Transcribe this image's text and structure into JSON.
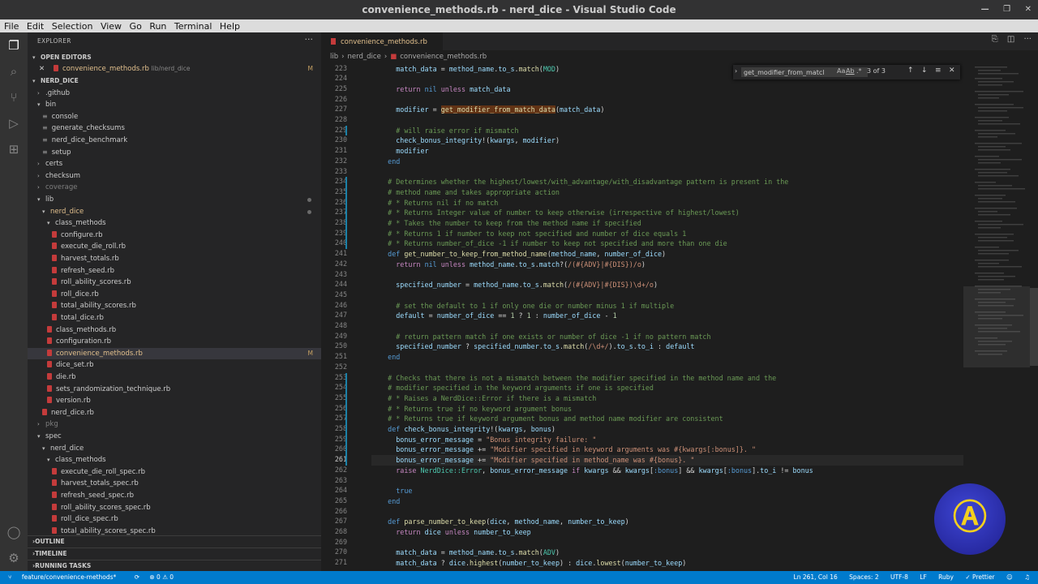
{
  "window": {
    "title": "convenience_methods.rb - nerd_dice - Visual Studio Code"
  },
  "menu": [
    "File",
    "Edit",
    "Selection",
    "View",
    "Go",
    "Run",
    "Terminal",
    "Help"
  ],
  "sidebar": {
    "header": "EXPLORER",
    "open_editors_label": "OPEN EDITORS",
    "open_editor": {
      "name": "convenience_methods.rb",
      "path": "lib/nerd_dice",
      "badge": "M"
    },
    "root_label": "NERD_DICE",
    "tree": [
      {
        "label": ".github",
        "kind": "folder",
        "indent": 1,
        "open": false
      },
      {
        "label": "bin",
        "kind": "folder",
        "indent": 1,
        "open": true
      },
      {
        "label": "console",
        "kind": "file",
        "indent": 2
      },
      {
        "label": "generate_checksums",
        "kind": "file",
        "indent": 2
      },
      {
        "label": "nerd_dice_benchmark",
        "kind": "file",
        "indent": 2
      },
      {
        "label": "setup",
        "kind": "file",
        "indent": 2
      },
      {
        "label": "certs",
        "kind": "folder",
        "indent": 1,
        "open": false
      },
      {
        "label": "checksum",
        "kind": "folder",
        "indent": 1,
        "open": false
      },
      {
        "label": "coverage",
        "kind": "folder",
        "indent": 1,
        "open": false,
        "dim": true
      },
      {
        "label": "lib",
        "kind": "folder",
        "indent": 1,
        "open": true,
        "dot": true
      },
      {
        "label": "nerd_dice",
        "kind": "folder",
        "indent": 2,
        "open": true,
        "dot": true,
        "mod": true
      },
      {
        "label": "class_methods",
        "kind": "folder",
        "indent": 3,
        "open": true
      },
      {
        "label": "configure.rb",
        "kind": "rb",
        "indent": 4
      },
      {
        "label": "execute_die_roll.rb",
        "kind": "rb",
        "indent": 4
      },
      {
        "label": "harvest_totals.rb",
        "kind": "rb",
        "indent": 4
      },
      {
        "label": "refresh_seed.rb",
        "kind": "rb",
        "indent": 4
      },
      {
        "label": "roll_ability_scores.rb",
        "kind": "rb",
        "indent": 4
      },
      {
        "label": "roll_dice.rb",
        "kind": "rb",
        "indent": 4
      },
      {
        "label": "total_ability_scores.rb",
        "kind": "rb",
        "indent": 4
      },
      {
        "label": "total_dice.rb",
        "kind": "rb",
        "indent": 4
      },
      {
        "label": "class_methods.rb",
        "kind": "rb",
        "indent": 3
      },
      {
        "label": "configuration.rb",
        "kind": "rb",
        "indent": 3
      },
      {
        "label": "convenience_methods.rb",
        "kind": "rb",
        "indent": 3,
        "selected": true,
        "mod": true,
        "badge": "M"
      },
      {
        "label": "dice_set.rb",
        "kind": "rb",
        "indent": 3
      },
      {
        "label": "die.rb",
        "kind": "rb",
        "indent": 3
      },
      {
        "label": "sets_randomization_technique.rb",
        "kind": "rb",
        "indent": 3
      },
      {
        "label": "version.rb",
        "kind": "rb",
        "indent": 3
      },
      {
        "label": "nerd_dice.rb",
        "kind": "rb",
        "indent": 2
      },
      {
        "label": "pkg",
        "kind": "folder",
        "indent": 1,
        "open": false,
        "dim": true
      },
      {
        "label": "spec",
        "kind": "folder",
        "indent": 1,
        "open": true
      },
      {
        "label": "nerd_dice",
        "kind": "folder",
        "indent": 2,
        "open": true
      },
      {
        "label": "class_methods",
        "kind": "folder",
        "indent": 3,
        "open": true
      },
      {
        "label": "execute_die_roll_spec.rb",
        "kind": "rb",
        "indent": 4
      },
      {
        "label": "harvest_totals_spec.rb",
        "kind": "rb",
        "indent": 4
      },
      {
        "label": "refresh_seed_spec.rb",
        "kind": "rb",
        "indent": 4
      },
      {
        "label": "roll_ability_scores_spec.rb",
        "kind": "rb",
        "indent": 4
      },
      {
        "label": "roll_dice_spec.rb",
        "kind": "rb",
        "indent": 4
      },
      {
        "label": "total_ability_scores_spec.rb",
        "kind": "rb",
        "indent": 4
      }
    ],
    "sections": [
      "OUTLINE",
      "TIMELINE",
      "RUNNING TASKS"
    ]
  },
  "tab": {
    "label": "convenience_methods.rb",
    "badge": "M"
  },
  "breadcrumb": [
    "lib",
    "nerd_dice",
    "convenience_methods.rb"
  ],
  "find": {
    "query": "get_modifier_from_matcl",
    "opt_case": "Aa",
    "opt_word": "Ab",
    "opt_regex": ".*",
    "count": "3 of 3"
  },
  "editor": {
    "current_line": 261,
    "changed_lines": [
      229,
      234,
      235,
      236,
      237,
      238,
      239,
      240,
      253,
      254,
      255,
      256,
      257,
      258,
      259,
      260,
      261
    ],
    "lines": [
      {
        "n": 223,
        "t": "      match_data = method_name.to_s.match(MOD)"
      },
      {
        "n": 224,
        "t": ""
      },
      {
        "n": 225,
        "t": "      return nil unless match_data"
      },
      {
        "n": 226,
        "t": ""
      },
      {
        "n": 227,
        "t": "      modifier = get_modifier_from_match_data(match_data)"
      },
      {
        "n": 228,
        "t": ""
      },
      {
        "n": 229,
        "t": "      # will raise error if mismatch"
      },
      {
        "n": 230,
        "t": "      check_bonus_integrity!(kwargs, modifier)"
      },
      {
        "n": 231,
        "t": "      modifier"
      },
      {
        "n": 232,
        "t": "    end"
      },
      {
        "n": 233,
        "t": ""
      },
      {
        "n": 234,
        "t": "    # Determines whether the highest/lowest/with_advantage/with_disadvantage pattern is present in the"
      },
      {
        "n": 235,
        "t": "    # method name and takes appropriate action"
      },
      {
        "n": 236,
        "t": "    # * Returns nil if no match"
      },
      {
        "n": 237,
        "t": "    # * Returns Integer value of number to keep otherwise (irrespective of highest/lowest)"
      },
      {
        "n": 238,
        "t": "    # * Takes the number to keep from the method name if specified"
      },
      {
        "n": 239,
        "t": "    # * Returns 1 if number to keep not specified and number of dice equals 1"
      },
      {
        "n": 240,
        "t": "    # * Returns number_of_dice -1 if number to keep not specified and more than one die"
      },
      {
        "n": 241,
        "t": "    def get_number_to_keep_from_method_name(method_name, number_of_dice)"
      },
      {
        "n": 242,
        "t": "      return nil unless method_name.to_s.match?(/(#{ADV}|#{DIS})/o)"
      },
      {
        "n": 243,
        "t": ""
      },
      {
        "n": 244,
        "t": "      specified_number = method_name.to_s.match(/(#{ADV}|#{DIS})\\d+/o)"
      },
      {
        "n": 245,
        "t": ""
      },
      {
        "n": 246,
        "t": "      # set the default to 1 if only one die or number minus 1 if multiple"
      },
      {
        "n": 247,
        "t": "      default = number_of_dice == 1 ? 1 : number_of_dice - 1"
      },
      {
        "n": 248,
        "t": ""
      },
      {
        "n": 249,
        "t": "      # return pattern match if one exists or number of dice -1 if no pattern match"
      },
      {
        "n": 250,
        "t": "      specified_number ? specified_number.to_s.match(/\\d+/).to_s.to_i : default"
      },
      {
        "n": 251,
        "t": "    end"
      },
      {
        "n": 252,
        "t": ""
      },
      {
        "n": 253,
        "t": "    # Checks that there is not a mismatch between the modifier specified in the method name and the"
      },
      {
        "n": 254,
        "t": "    # modifier specified in the keyword arguments if one is specified"
      },
      {
        "n": 255,
        "t": "    # * Raises a NerdDice::Error if there is a mismatch"
      },
      {
        "n": 256,
        "t": "    # * Returns true if no keyword argument bonus"
      },
      {
        "n": 257,
        "t": "    # * Returns true if keyword argument bonus and method name modifier are consistent"
      },
      {
        "n": 258,
        "t": "    def check_bonus_integrity!(kwargs, bonus)"
      },
      {
        "n": 259,
        "t": "      bonus_error_message = \"Bonus integrity failure: \""
      },
      {
        "n": 260,
        "t": "      bonus_error_message += \"Modifier specified in keyword arguments was #{kwargs[:bonus]}. \""
      },
      {
        "n": 261,
        "t": "      bonus_error_message += \"Modifier specified in method_name was #{bonus}. \""
      },
      {
        "n": 262,
        "t": "      raise NerdDice::Error, bonus_error_message if kwargs && kwargs[:bonus] && kwargs[:bonus].to_i != bonus"
      },
      {
        "n": 263,
        "t": ""
      },
      {
        "n": 264,
        "t": "      true"
      },
      {
        "n": 265,
        "t": "    end"
      },
      {
        "n": 266,
        "t": ""
      },
      {
        "n": 267,
        "t": "    def parse_number_to_keep(dice, method_name, number_to_keep)"
      },
      {
        "n": 268,
        "t": "      return dice unless number_to_keep"
      },
      {
        "n": 269,
        "t": ""
      },
      {
        "n": 270,
        "t": "      match_data = method_name.to_s.match(ADV)"
      },
      {
        "n": 271,
        "t": "      match_data ? dice.highest(number_to_keep) : dice.lowest(number_to_keep)"
      }
    ],
    "highlight": "get_modifier_from_match_data"
  },
  "status": {
    "branch": "feature/convenience-methods*",
    "sync": "⟳",
    "problems": "⊗ 0 ⚠ 0",
    "cursor": "Ln 261, Col 16",
    "spaces": "Spaces: 2",
    "encoding": "UTF-8",
    "eol": "LF",
    "language": "Ruby",
    "prettier": "✓ Prettier"
  },
  "colors": {
    "statusbar": "#007acc",
    "editor_bg": "#1e1e1e",
    "sidebar_bg": "#252526",
    "ruby_icon": "#c43b3b",
    "modified": "#e2c08d"
  }
}
